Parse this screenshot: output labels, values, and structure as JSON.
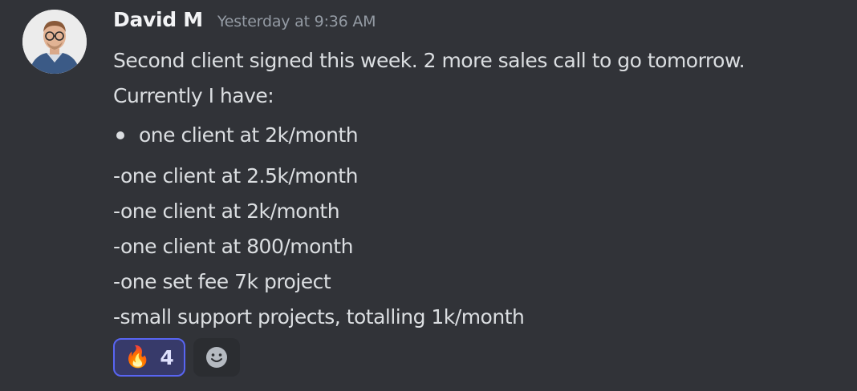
{
  "message": {
    "author": "David M",
    "timestamp": "Yesterday at 9:36 AM",
    "lines_intro": [
      "Second client signed this week. 2 more sales call to go tomorrow.",
      "Currently I have:"
    ],
    "bullets": [
      "one client at 2k/month"
    ],
    "lines_after": [
      "-one client at 2.5k/month",
      "-one client at 2k/month",
      "-one client at 800/month",
      "-one set fee 7k project",
      "-small support projects, totalling 1k/month"
    ],
    "reactions": [
      {
        "emoji": "🔥",
        "emoji_name": "fire-emoji",
        "count": "4",
        "active": true
      }
    ],
    "add_reaction_icon": "smiley-add-reaction-icon"
  },
  "colors": {
    "background": "#313338",
    "author": "#f2f3f5",
    "timestamp": "#949ba4",
    "text": "#dbdee1",
    "reaction_border": "#5865f2",
    "reaction_bg": "#373a6a"
  }
}
